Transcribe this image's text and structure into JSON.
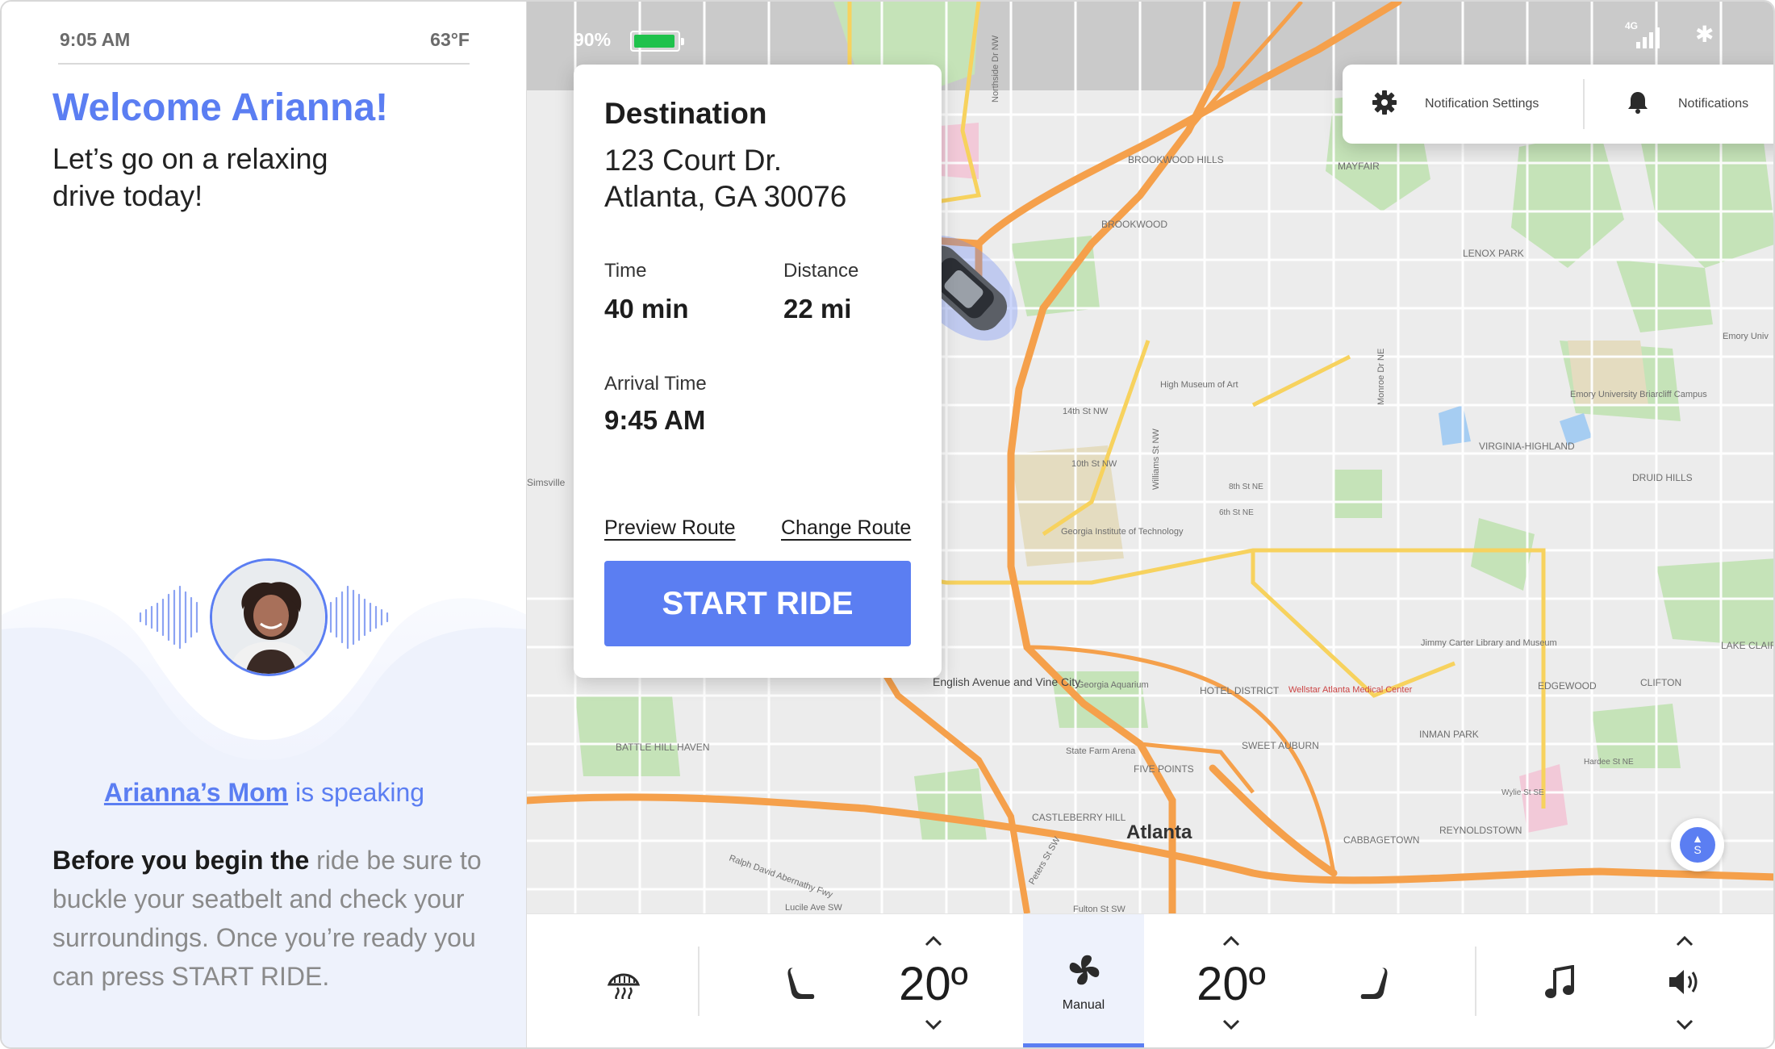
{
  "status": {
    "time": "9:05 AM",
    "temperature": "63°F",
    "battery": "90%",
    "network": "4G"
  },
  "greeting": {
    "title": "Welcome Arianna!",
    "subtitle": "Let’s go on a relaxing drive today!"
  },
  "caller": {
    "name": "Arianna’s Mom",
    "suffix": " is speaking"
  },
  "instructions": {
    "lead": "Before you begin the",
    "rest": " ride be sure to buckle your seatbelt and check your surroundings. Once you’re ready you can press START RIDE."
  },
  "destination": {
    "heading": "Destination",
    "address_line1": "123 Court Dr.",
    "address_line2": "Atlanta, GA 30076",
    "time_label": "Time",
    "time_value": "40 min",
    "distance_label": "Distance",
    "distance_value": "22 mi",
    "arrival_label": "Arrival Time",
    "arrival_value": "9:45 AM",
    "preview_route": "Preview Route",
    "change_route": "Change Route",
    "start_button": "START RIDE"
  },
  "notifications": {
    "settings_label": "Notification Settings",
    "notifications_label": "Notifications"
  },
  "map": {
    "labels": {
      "atlanta": "Atlanta",
      "brookwood": "BROOKWOOD",
      "brookwood_hills": "BROOKWOOD HILLS",
      "mayfair": "MAYFAIR",
      "lenox_park": "LENOX PARK",
      "virginia_highland": "VIRGINIA-HIGHLAND",
      "druid_hills": "DRUID HILLS",
      "emory": "Emory University Briarcliff Campus",
      "high_museum": "High Museum of Art",
      "georgia_tech": "Georgia Institute of Technology",
      "english_avenue": "English Avenue and Vine City",
      "georgia_aquarium": "Georgia Aquarium",
      "hotel_district": "HOTEL DISTRICT",
      "wellstar": "Wellstar Atlanta Medical Center",
      "inman_park": "INMAN PARK",
      "edgewood": "EDGEWOOD",
      "clifton": "CLIFTON",
      "jimmy_carter": "Jimmy Carter Library and Museum",
      "state_farm": "State Farm Arena",
      "five_points": "FIVE POINTS",
      "sweet_auburn": "SWEET AUBURN",
      "castleberry": "CASTLEBERRY HILL",
      "cabbagetown": "CABBAGETOWN",
      "reynoldstown": "REYNOLDSTOWN",
      "battle_hill": "BATTLE HILL HAVEN",
      "lake_claire": "LAKE CLAIRE",
      "st14": "14th St NW",
      "st10": "10th St NW",
      "st8": "8th St NE",
      "st6": "6th St NE",
      "monroe": "Monroe Dr NE",
      "williams": "Williams St NW",
      "northside": "Northside Dr NW",
      "ralph": "Ralph David Abernathy Fwy",
      "lucile": "Lucile Ave SW",
      "fulton": "Fulton St SW",
      "peters": "Peters St SW",
      "hardee": "Hardee St NE",
      "wylie": "Wylie St SE",
      "simsville": "Simsville",
      "emory_univ": "Emory Univ"
    }
  },
  "controls": {
    "left_temp": "20º",
    "right_temp": "20º",
    "fan_mode": "Manual"
  },
  "colors": {
    "accent": "#5b7ef2",
    "highway": "#f5a04b",
    "arterial": "#f7d25e",
    "park": "#c5e3b8",
    "water": "#a6cdf2"
  }
}
